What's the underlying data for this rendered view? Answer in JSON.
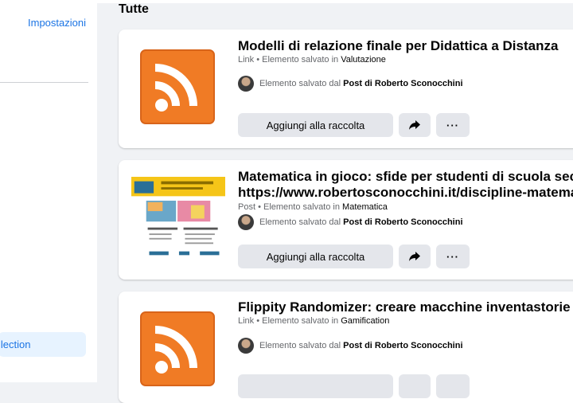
{
  "sidebar": {
    "settings_label": "Impostazioni",
    "collection_label": "llection"
  },
  "main": {
    "section_title": "Tutte",
    "cards": [
      {
        "title_line1": "Modelli di relazione finale per Didattica a Distanza",
        "title_line2": "",
        "type": "Link",
        "meta_prefix": " • Elemento salvato in ",
        "collection": "Valutazione",
        "saved_prefix": "Elemento salvato dal ",
        "saved_source": "Post di Roberto Sconocchini",
        "thumbnail": "rss-icon"
      },
      {
        "title_line1": "Matematica in gioco: sfide per studenti di scuola seco",
        "title_line2": "https://www.robertosconocchini.it/discipline-matema",
        "type": "Post",
        "meta_prefix": " • Elemento salvato in ",
        "collection": "Matematica",
        "saved_prefix": "Elemento salvato dal ",
        "saved_source": "Post di Roberto Sconocchini",
        "thumbnail": "article-preview-image"
      },
      {
        "title_line1": "Flippity Randomizer: creare macchine inventastorie",
        "title_line2": "",
        "type": "Link",
        "meta_prefix": " • Elemento salvato in ",
        "collection": "Gamification",
        "saved_prefix": "Elemento salvato dal ",
        "saved_source": "Post di Roberto Sconocchini",
        "thumbnail": "rss-icon"
      }
    ],
    "add_to_collection_label": "Aggiungi alla raccolta",
    "more_label": "···"
  },
  "colors": {
    "accent": "#1b74e4",
    "rss_orange": "#f07b25",
    "button_bg": "#e4e6eb",
    "page_bg": "#f0f2f5"
  }
}
